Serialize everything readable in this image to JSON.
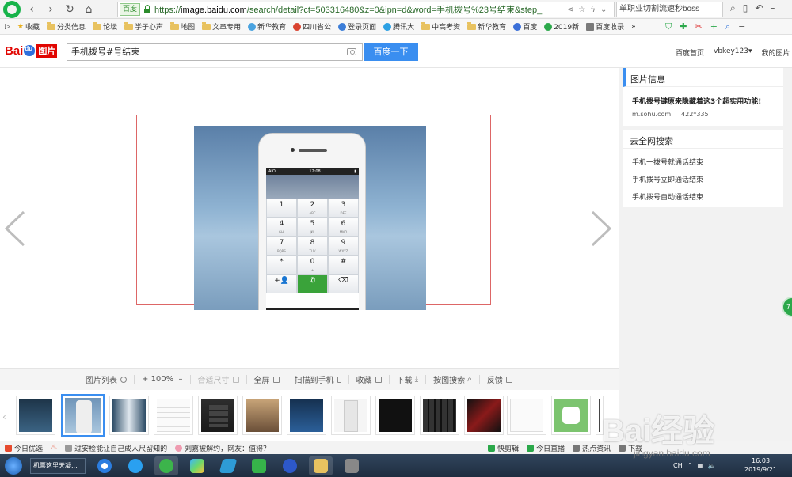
{
  "browser": {
    "address_badge": "百度",
    "url_prefix": "https://",
    "url_domain": "image.baidu.com",
    "url_rest": "/search/detail?ct=503316480&z=0&ipn=d&word=手机拨号%23号结束&step_",
    "right_search": "单职业切割流速秒boss"
  },
  "bookmarks": {
    "items": [
      {
        "label": "收藏",
        "icon": "star-icon"
      },
      {
        "label": "分类信息",
        "icon": "folder-icon"
      },
      {
        "label": "论坛",
        "icon": "folder-icon"
      },
      {
        "label": "学子心声",
        "icon": "folder-icon"
      },
      {
        "label": "地图",
        "icon": "folder-icon"
      },
      {
        "label": "文章专用",
        "icon": "folder-icon"
      },
      {
        "label": "新华教育",
        "icon": "site-icon"
      },
      {
        "label": "四川省公",
        "icon": "site-icon"
      },
      {
        "label": "登录页面",
        "icon": "site-icon"
      },
      {
        "label": "腾讯大",
        "icon": "site-icon"
      },
      {
        "label": "中高考资",
        "icon": "folder-icon"
      },
      {
        "label": "新华教育",
        "icon": "folder-icon"
      },
      {
        "label": "百度",
        "icon": "site-icon"
      },
      {
        "label": "2019新",
        "icon": "site-icon"
      },
      {
        "label": "百度收录",
        "icon": "site-icon"
      }
    ]
  },
  "header": {
    "search_value": "手机拨号#号结束",
    "search_button": "百度一下",
    "links": [
      "百度首页",
      "vbkey123",
      "我的图片"
    ]
  },
  "toolbar": {
    "items": [
      "图片列表",
      "100%",
      "合适尺寸",
      "全屏",
      "扫描到手机",
      "收藏",
      "下载",
      "按图搜索",
      "反馈"
    ]
  },
  "phone": {
    "time": "12:08",
    "carrier": "AIO",
    "keys": [
      {
        "num": "1",
        "sub": ""
      },
      {
        "num": "2",
        "sub": "ABC"
      },
      {
        "num": "3",
        "sub": "DEF"
      },
      {
        "num": "4",
        "sub": "GHI"
      },
      {
        "num": "5",
        "sub": "JKL"
      },
      {
        "num": "6",
        "sub": "MNO"
      },
      {
        "num": "7",
        "sub": "PQRS"
      },
      {
        "num": "8",
        "sub": "TUV"
      },
      {
        "num": "9",
        "sub": "WXYZ"
      },
      {
        "num": "*",
        "sub": ""
      },
      {
        "num": "0",
        "sub": "+"
      },
      {
        "num": "#",
        "sub": ""
      }
    ]
  },
  "right_panel": {
    "info_heading": "图片信息",
    "info_title": "手机拨号键原来隐藏着这3个超实用功能!",
    "info_source": "m.sohu.com",
    "info_size": "422*335",
    "search_heading": "去全网搜索",
    "related": [
      "手机一拨号就通话结束",
      "手机拨号立即通话结束",
      "手机拨号自动通话结束"
    ]
  },
  "statusbar": {
    "items": [
      "今日优选",
      "过安检能让自己成人尺留知的",
      "刘嘉被解约，网友：值得？",
      "快剪辑",
      "今日直播",
      "热点资讯",
      "下载"
    ]
  },
  "taskbar": {
    "search_text": "机票这里天凝...",
    "ime": "CH",
    "time": "16:03",
    "date": "2019/9/21"
  },
  "watermark": {
    "brand": "Bai经验",
    "sub": "jingyan.baidu.com"
  }
}
